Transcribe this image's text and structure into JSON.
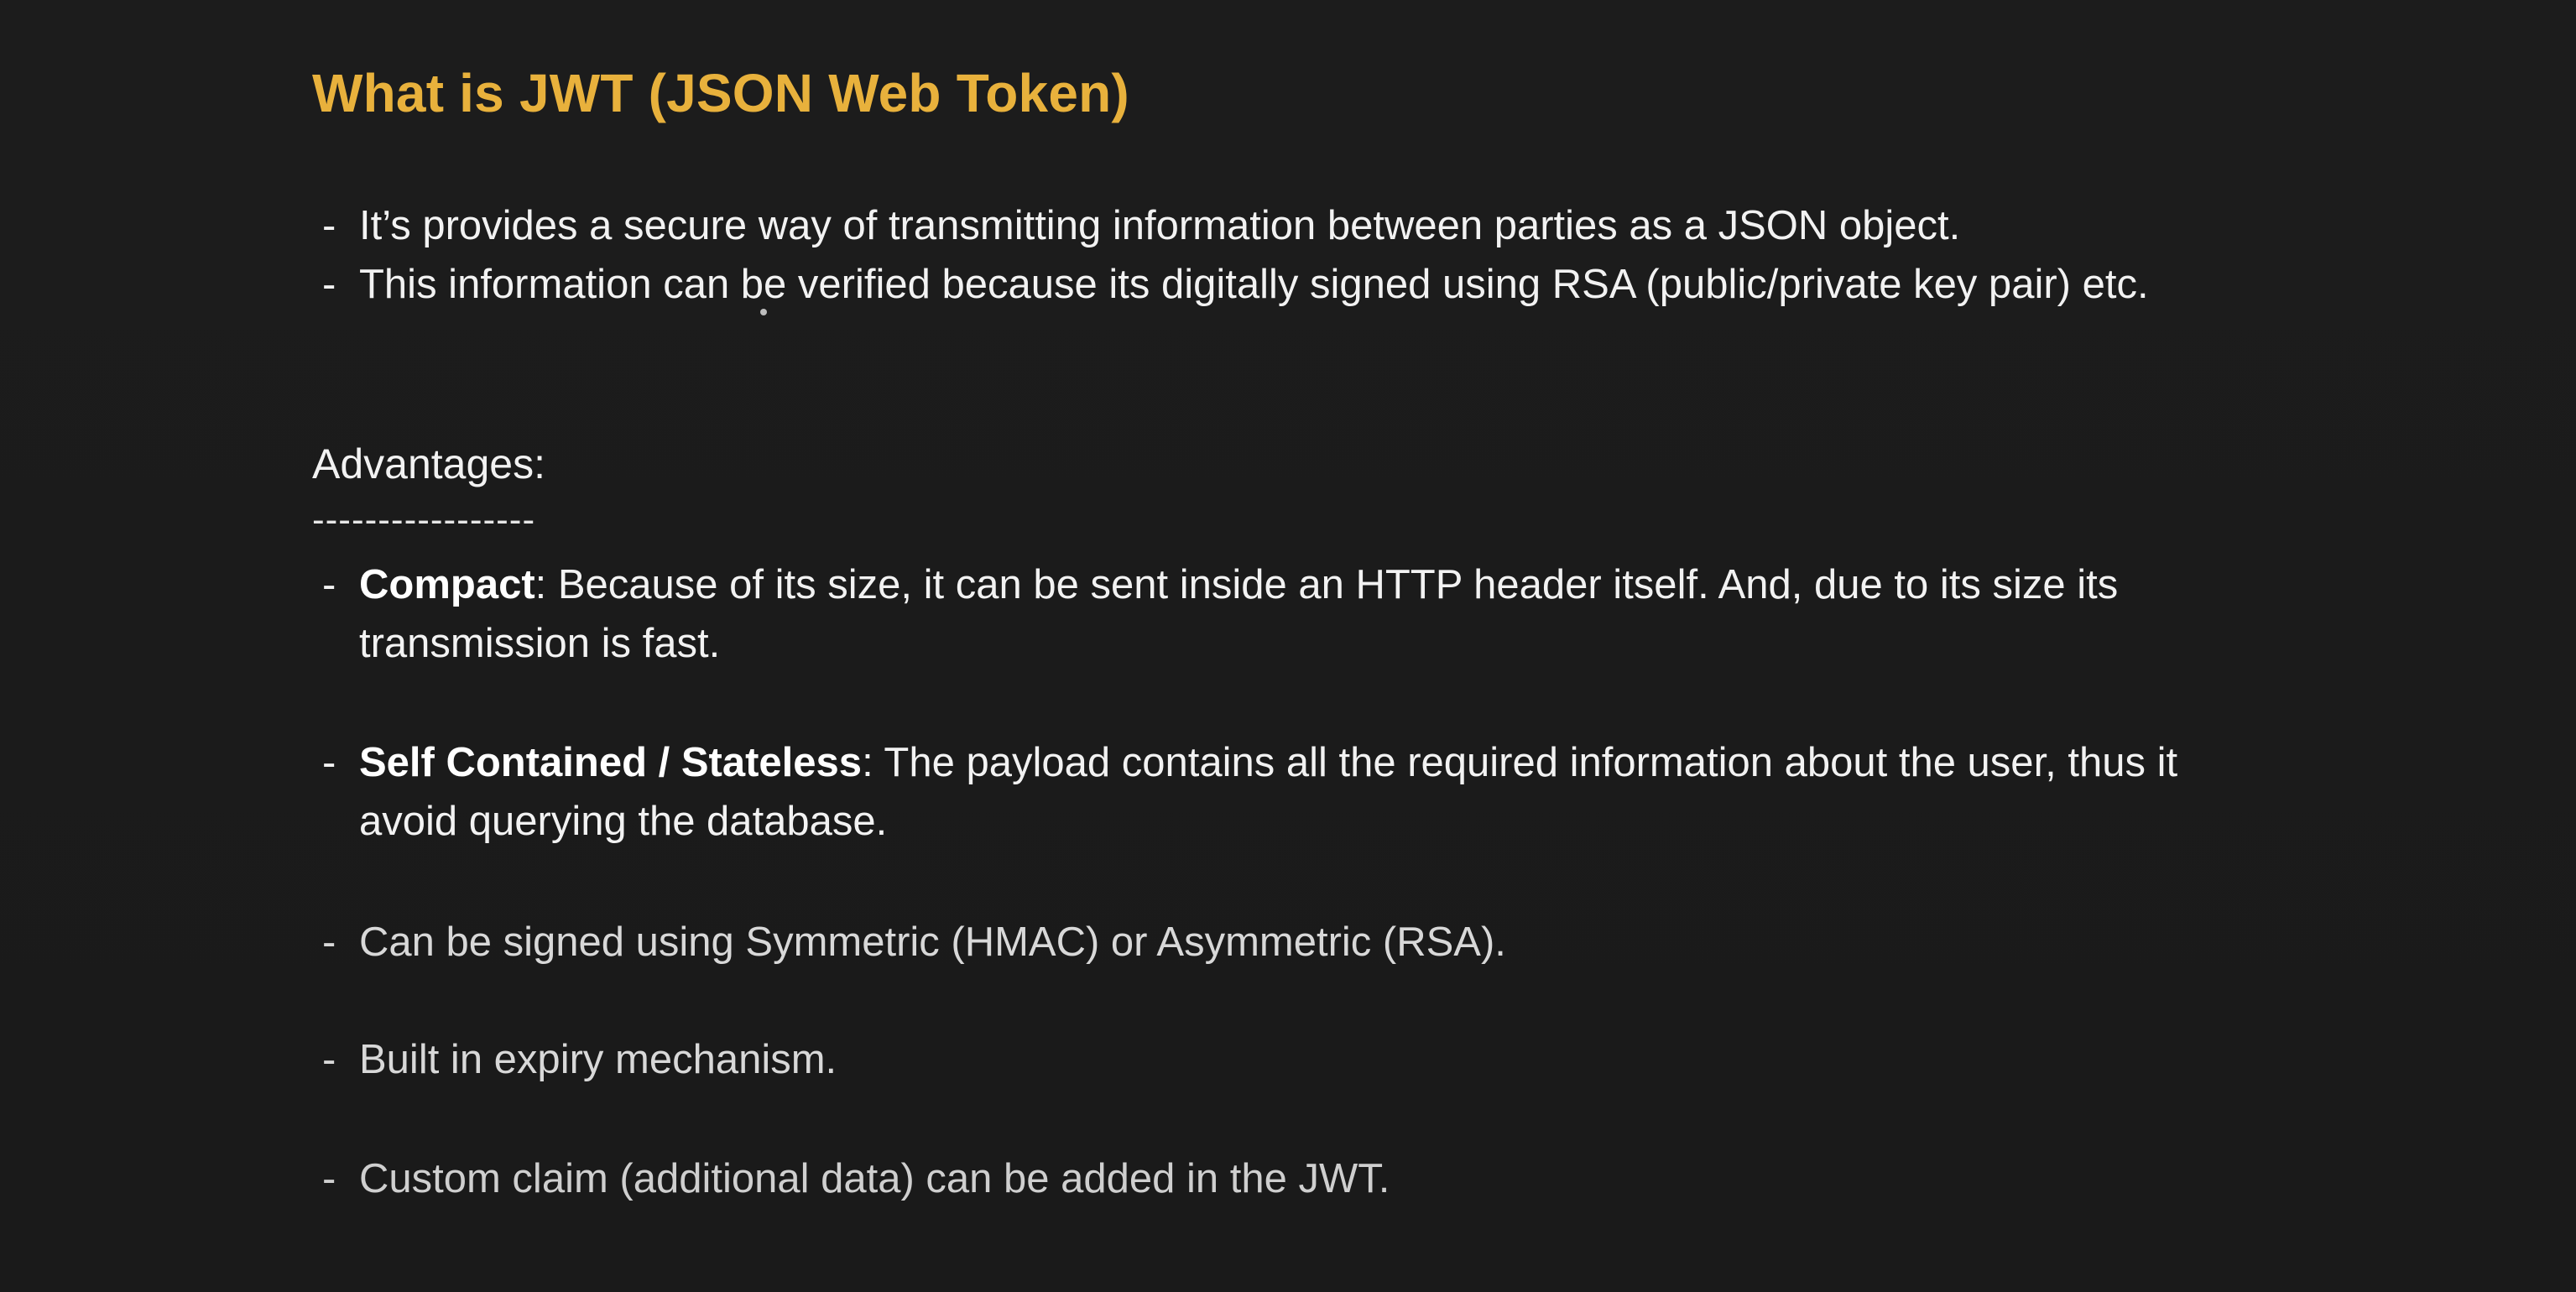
{
  "slide": {
    "title": "What is JWT (JSON Web Token)",
    "intro_bullets": [
      "It’s provides a secure way of transmitting information between parties as a JSON object.",
      "This information can be verified because its digitally signed using RSA (public/private key pair) etc."
    ],
    "advantages_heading": "Advantages:",
    "advantages_rule": "-----------------",
    "advantages": [
      {
        "term": "Compact",
        "text_line1": ": Because of its size, it can be sent inside an HTTP header itself. And, due to its size its",
        "text_line2": "transmission is fast."
      },
      {
        "term": "Self Contained / Stateless",
        "text_line1": ": The payload contains all the required information about the user, thus it",
        "text_line2": "avoid querying the database."
      },
      {
        "term": "",
        "text_line1": "Can be signed using Symmetric (HMAC) or Asymmetric (RSA).",
        "text_line2": ""
      },
      {
        "term": "",
        "text_line1": "Built in expiry mechanism.",
        "text_line2": ""
      },
      {
        "term": "",
        "text_line1": "Custom claim (additional data) can be added in the JWT.",
        "text_line2": ""
      }
    ],
    "dash": "-"
  },
  "colors": {
    "background": "#1b1b1b",
    "title": "#e8b13c",
    "text": "#f2f2f2"
  }
}
